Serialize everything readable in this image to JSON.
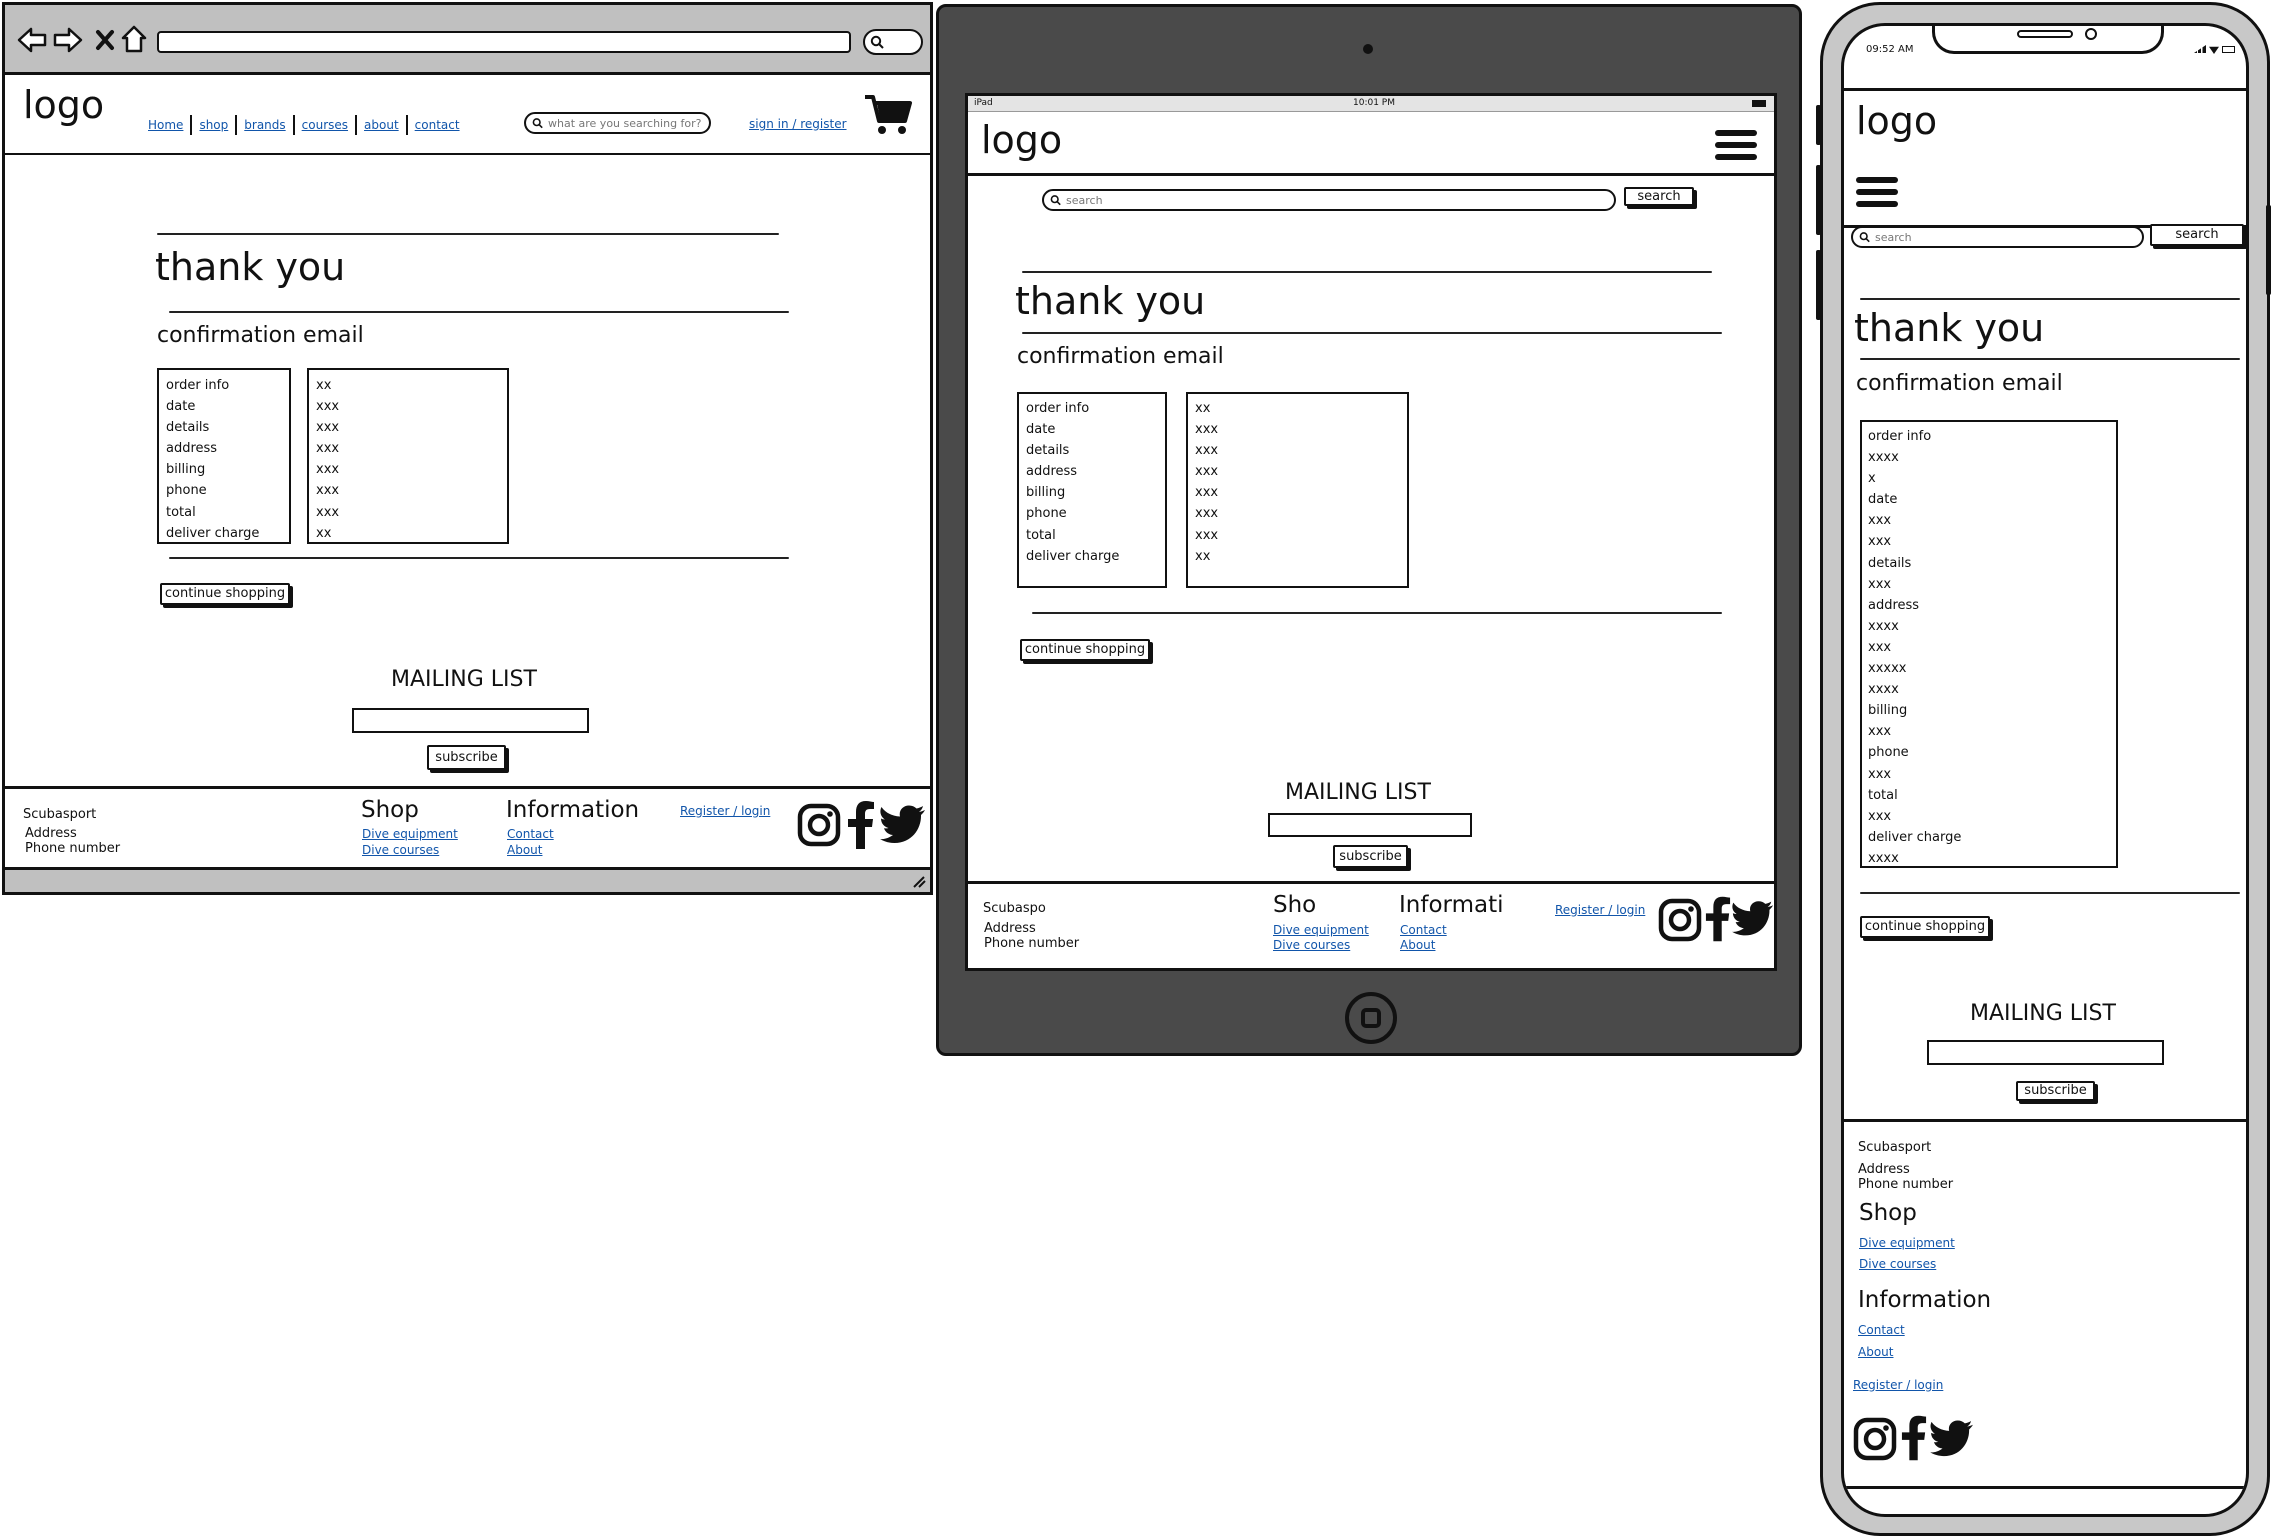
{
  "desktop": {
    "logo": "logo",
    "nav": [
      "Home",
      "shop",
      "brands",
      "courses",
      "about",
      "contact"
    ],
    "search_placeholder": "what are you searching for?",
    "signin": "sign in / register",
    "title": "thank you",
    "subtitle": "confirmation email",
    "labels": [
      "order info",
      "date",
      "details",
      "address",
      "billing",
      "phone",
      "total",
      "deliver charge"
    ],
    "values": [
      "xx",
      "xxx",
      "xxx",
      "xxx",
      "xxx",
      "xxx",
      "xxx",
      "xx"
    ],
    "continue": "continue shopping",
    "mailing": "MAILING LIST",
    "subscribe": "subscribe",
    "footer": {
      "brand": "Scubasport",
      "address": "Address",
      "phone": "Phone number",
      "shop_title": "Shop",
      "shop_links": [
        "Dive equipment",
        "Dive courses"
      ],
      "info_title": "Information",
      "info_links": [
        "Contact",
        "About"
      ],
      "register": "Register / login"
    }
  },
  "tablet": {
    "status_left": "iPad",
    "status_time": "10:01 PM",
    "logo": "logo",
    "search_placeholder": "search",
    "search_btn": "search",
    "title": "thank you",
    "subtitle": "confirmation email",
    "labels": [
      "order info",
      "date",
      "details",
      "address",
      "billing",
      "phone",
      "total",
      "deliver charge"
    ],
    "values": [
      "xx",
      "xxx",
      "xxx",
      "xxx",
      "xxx",
      "xxx",
      "xxx",
      "xx"
    ],
    "continue": "continue shopping",
    "mailing": "MAILING LIST",
    "subscribe": "subscribe",
    "footer": {
      "brand": "Scubaspo",
      "address": "Address",
      "phone": "Phone number",
      "shop_title": "Sho",
      "shop_links": [
        "Dive equipment",
        "Dive courses"
      ],
      "info_title": "Informati",
      "info_links": [
        "Contact",
        "About"
      ],
      "register": "Register / login"
    }
  },
  "phone": {
    "status_time": "09:52 AM",
    "logo": "logo",
    "search_placeholder": "search",
    "search_btn": "search",
    "title": "thank you",
    "subtitle": "confirmation email",
    "rows": [
      "order info",
      "xxxx",
      "x",
      "date",
      "xxx",
      "xxx",
      "details",
      "xxx",
      "address",
      "xxxx",
      "xxx",
      "xxxxx",
      "xxxx",
      "billing",
      "xxx",
      "phone",
      "xxx",
      "total",
      "xxx",
      "deliver charge",
      "xxxx"
    ],
    "continue": "continue shopping",
    "mailing": "MAILING LIST",
    "subscribe": "subscribe",
    "footer": {
      "brand": "Scubasport",
      "address": "Address",
      "phone": "Phone number",
      "shop_title": "Shop",
      "shop_links": [
        "Dive equipment",
        "Dive courses"
      ],
      "info_title": "Information",
      "info_links": [
        "Contact",
        "About"
      ],
      "register": "Register / login"
    }
  },
  "colors": {
    "link": "#1155aa",
    "frame_gray": "#c0c0c0",
    "tablet_body": "#4a4a4a"
  },
  "icons": [
    "back-arrow-icon",
    "forward-arrow-icon",
    "close-icon",
    "home-icon",
    "search-icon",
    "cart-icon",
    "menu-icon",
    "instagram-icon",
    "facebook-icon",
    "twitter-icon"
  ]
}
